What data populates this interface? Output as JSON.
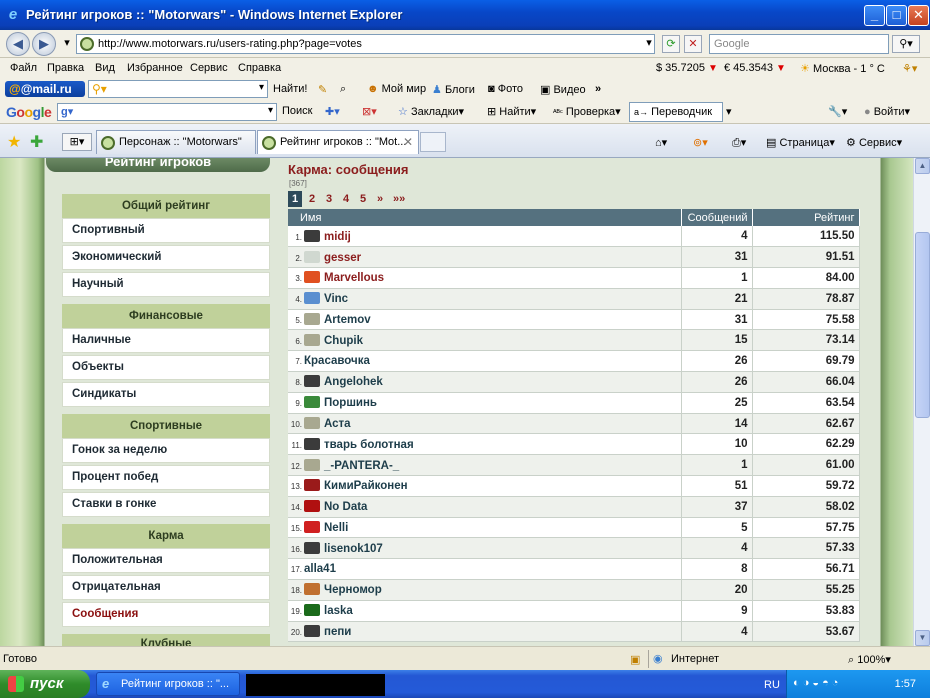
{
  "window": {
    "title": "Рейтинг игроков :: \"Motorwars\" - Windows Internet Explorer"
  },
  "address": {
    "url": "http://www.motorwars.ru/users-rating.php?page=votes",
    "search_placeholder": "Google"
  },
  "menu": {
    "items": [
      "Файл",
      "Правка",
      "Вид",
      "Избранное",
      "Сервис",
      "Справка"
    ],
    "usd": "$ 35.7205",
    "eur": "€ 45.3543",
    "weather": "Москва - 1 ° C"
  },
  "mailru": {
    "logo": "@mail.ru",
    "find": "Найти!",
    "my_world": "Мой мир",
    "blogs": "Блоги",
    "photo": "Фото",
    "video": "Видео"
  },
  "google_bar": {
    "logo": "Google",
    "search": "Поиск",
    "bookmarks": "Закладки",
    "find": "Найти",
    "check": "Проверка",
    "translator": "Переводчик",
    "login": "Войти"
  },
  "tabs": [
    {
      "label": "Персонаж :: \"Motorwars\""
    },
    {
      "label": "Рейтинг игроков :: \"Mot..."
    }
  ],
  "commandbar": {
    "page": "Страница",
    "service": "Сервис"
  },
  "sidebar": {
    "old_header": "Рейтинг игроков",
    "sections": [
      {
        "title": "Общий рейтинг",
        "items": [
          "Спортивный",
          "Экономический",
          "Научный"
        ]
      },
      {
        "title": "Финансовые",
        "items": [
          "Наличные",
          "Объекты",
          "Синдикаты"
        ]
      },
      {
        "title": "Спортивные",
        "items": [
          "Гонок за неделю",
          "Процент побед",
          "Ставки в гонке"
        ]
      },
      {
        "title": "Карма",
        "items": [
          "Положительная",
          "Отрицательная",
          "Сообщения"
        ]
      },
      {
        "title": "Клубные",
        "items": []
      }
    ]
  },
  "main": {
    "title": "Карма: сообщения",
    "count": "[367]",
    "pages": [
      "1",
      "2",
      "3",
      "4",
      "5",
      "»",
      "»»"
    ],
    "current_page": "1",
    "columns": [
      "Имя",
      "Сообщений",
      "Рейтинг"
    ],
    "rows": [
      {
        "idx": "1.",
        "name": "midij",
        "msgs": "4",
        "rating": "115.50",
        "red": true,
        "av": "#3b3b3b"
      },
      {
        "idx": "2.",
        "name": "gesser",
        "msgs": "31",
        "rating": "91.51",
        "red": true,
        "av": "#d0d8d0"
      },
      {
        "idx": "3.",
        "name": "Marvellous",
        "msgs": "1",
        "rating": "84.00",
        "red": true,
        "av": "#e05020"
      },
      {
        "idx": "4.",
        "name": "Vinc",
        "msgs": "21",
        "rating": "78.87",
        "red": false,
        "av": "#5a8fd0"
      },
      {
        "idx": "5.",
        "name": "Artemov",
        "msgs": "31",
        "rating": "75.58",
        "red": false,
        "av": "#a8a890"
      },
      {
        "idx": "6.",
        "name": "Chupik",
        "msgs": "15",
        "rating": "73.14",
        "red": false,
        "av": "#a8a890"
      },
      {
        "idx": "7.",
        "name": "Красавочка",
        "msgs": "26",
        "rating": "69.79",
        "red": false,
        "av": ""
      },
      {
        "idx": "8.",
        "name": "Angelohek",
        "msgs": "26",
        "rating": "66.04",
        "red": false,
        "av": "#3b3b3b"
      },
      {
        "idx": "9.",
        "name": "Поршинь",
        "msgs": "25",
        "rating": "63.54",
        "red": false,
        "av": "#3a8a3a"
      },
      {
        "idx": "10.",
        "name": "Аста",
        "msgs": "14",
        "rating": "62.67",
        "red": false,
        "av": "#a8a890"
      },
      {
        "idx": "11.",
        "name": "тварь болотная",
        "msgs": "10",
        "rating": "62.29",
        "red": false,
        "av": "#3b3b3b"
      },
      {
        "idx": "12.",
        "name": "_-PANTERA-_",
        "msgs": "1",
        "rating": "61.00",
        "red": false,
        "av": "#a8a890"
      },
      {
        "idx": "13.",
        "name": "КимиРайконен",
        "msgs": "51",
        "rating": "59.72",
        "red": false,
        "av": "#9a1a1a"
      },
      {
        "idx": "14.",
        "name": "No Data",
        "msgs": "37",
        "rating": "58.02",
        "red": false,
        "av": "#b01010"
      },
      {
        "idx": "15.",
        "name": "Nelli",
        "msgs": "5",
        "rating": "57.75",
        "red": false,
        "av": "#d02020"
      },
      {
        "idx": "16.",
        "name": "lisenok107",
        "msgs": "4",
        "rating": "57.33",
        "red": false,
        "av": "#3b3b3b"
      },
      {
        "idx": "17.",
        "name": "alla41",
        "msgs": "8",
        "rating": "56.71",
        "red": false,
        "av": ""
      },
      {
        "idx": "18.",
        "name": "Черномор",
        "msgs": "20",
        "rating": "55.25",
        "red": false,
        "av": "#c07030"
      },
      {
        "idx": "19.",
        "name": "laska",
        "msgs": "9",
        "rating": "53.83",
        "red": false,
        "av": "#1a6a1a"
      },
      {
        "idx": "20.",
        "name": "пепи",
        "msgs": "4",
        "rating": "53.67",
        "red": false,
        "av": "#3b3b3b"
      }
    ]
  },
  "statusbar": {
    "status": "Готово",
    "zone": "Интернет",
    "zoom": "100%"
  },
  "taskbar": {
    "start": "пуск",
    "window_item": "Рейтинг игроков :: \"...",
    "lang": "RU",
    "clock": "1:57"
  }
}
